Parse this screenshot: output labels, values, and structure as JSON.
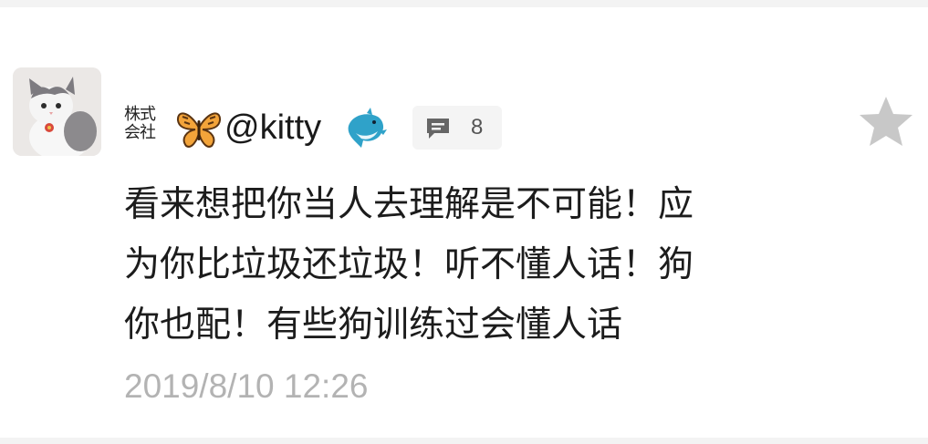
{
  "comment": {
    "avatar_icon": "cat-avatar",
    "badge": {
      "line1": "株式",
      "line2": "会社"
    },
    "decorations": {
      "before_name": "butterfly-emoji",
      "after_name": "dolphin-emoji"
    },
    "username": "@kitty",
    "reply_count": "8",
    "text_lines": [
      "看来想把你当人去理解是不可能！应",
      "为你比垃圾还垃圾！听不懂人话！狗",
      "你也配！有些狗训练过会懂人话"
    ],
    "timestamp": "2019/8/10 12:26",
    "colors": {
      "text": "#1c1c1c",
      "timestamp": "#b3b3b3",
      "star": "#c8c8c8",
      "reply_badge_bg": "#f4f4f4"
    }
  }
}
